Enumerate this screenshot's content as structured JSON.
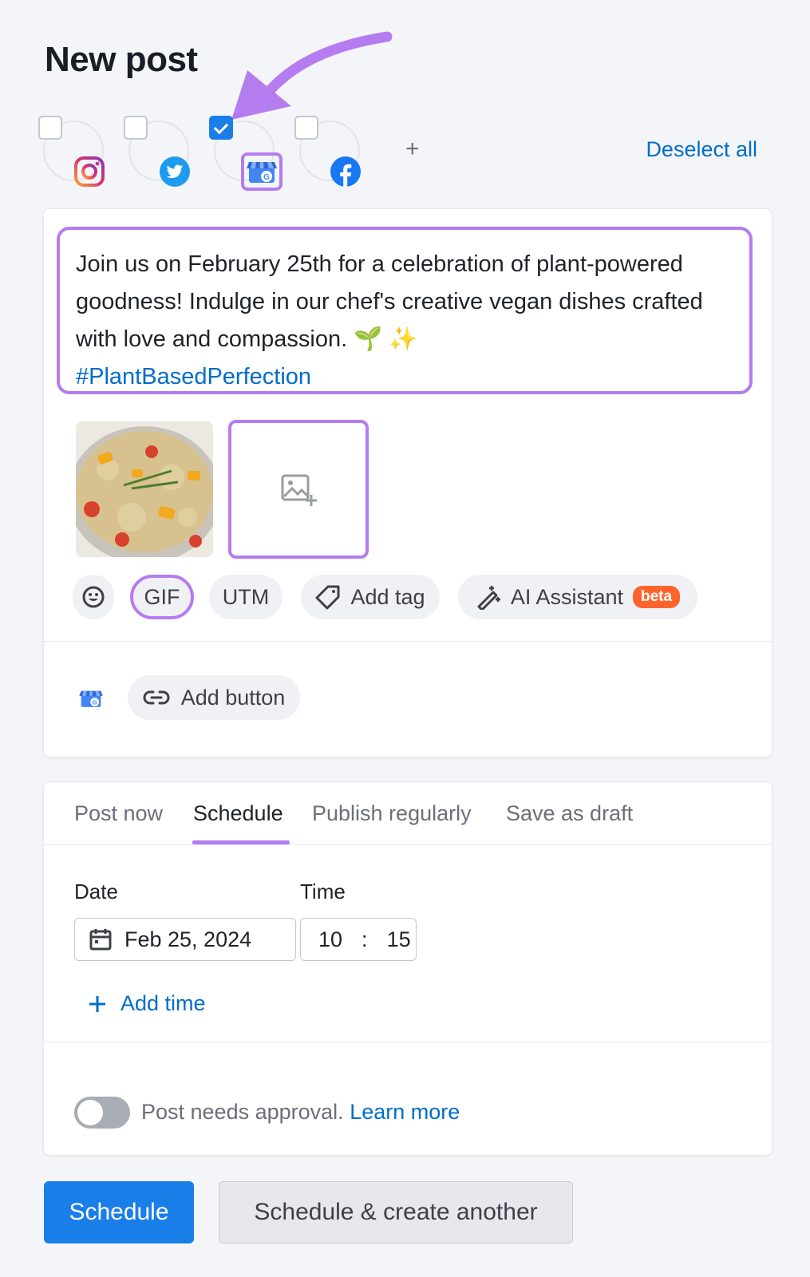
{
  "page": {
    "title": "New post"
  },
  "networks": {
    "items": [
      {
        "name": "Instagram",
        "checked": false,
        "icon": "instagram-icon"
      },
      {
        "name": "Twitter",
        "checked": false,
        "icon": "twitter-icon"
      },
      {
        "name": "Google Business Profile",
        "checked": true,
        "icon": "google-business-icon"
      },
      {
        "name": "Facebook",
        "checked": false,
        "icon": "facebook-icon"
      }
    ],
    "add_label": "+",
    "deselect_all": "Deselect all"
  },
  "composer": {
    "text": "Join us on February 25th for a celebration of plant-powered goodness! Indulge in our chef's creative vegan dishes crafted with love and compassion. 🌱 ✨",
    "hashtag": "#PlantBasedPerfection"
  },
  "toolbar": {
    "gif": "GIF",
    "utm": "UTM",
    "add_tag": "Add tag",
    "ai_assistant": "AI Assistant",
    "beta": "beta"
  },
  "cta": {
    "add_button": "Add button"
  },
  "tabs": [
    "Post now",
    "Schedule",
    "Publish regularly",
    "Save as draft"
  ],
  "active_tab": "Schedule",
  "schedule": {
    "date_label": "Date",
    "time_label": "Time",
    "date_value": "Feb 25, 2024",
    "hour": "10",
    "minute": "15",
    "add_time": "Add time"
  },
  "approval": {
    "text": "Post needs approval.",
    "link": "Learn more",
    "enabled": false
  },
  "actions": {
    "primary": "Schedule",
    "secondary": "Schedule & create another"
  },
  "colors": {
    "accent": "#1a7ee8",
    "highlight": "#b57cf0",
    "link": "#006dca",
    "beta": "#ff642d"
  }
}
